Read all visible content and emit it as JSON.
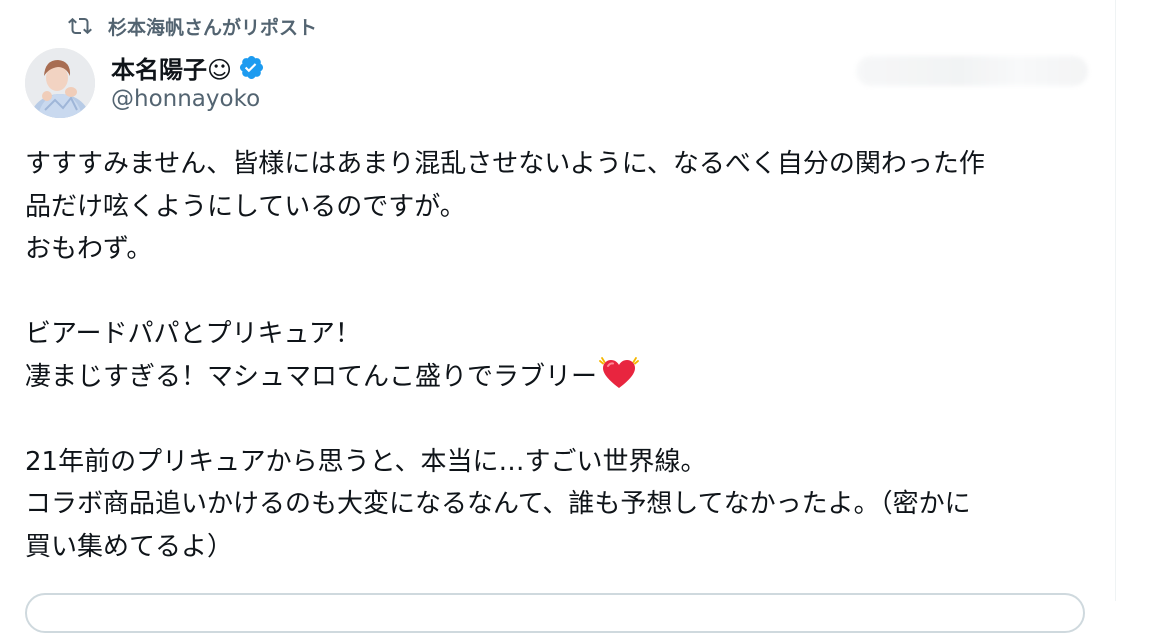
{
  "repost": {
    "label": "杉本海帆さんがリポスト",
    "icon": "repost-icon"
  },
  "author": {
    "display_name": "本名陽子☺",
    "handle": "@honnayoko",
    "verified": true,
    "verified_icon": "verified-badge-icon",
    "verified_color": "#1d9bf0"
  },
  "tweet": {
    "lines": [
      "すすすみません、皆様にはあまり混乱させないように、なるべく自分の関わった作",
      "品だけ呟くようにしているのですが。",
      "おもわず。",
      "",
      "ビアードパパとプリキュア！",
      "凄まじすぎる！マシュマロてんこ盛りでラブリー",
      "",
      "21年前のプリキュアから思うと、本当に…すごい世界線。",
      "コラボ商品追いかけるのも大変になるなんて、誰も予想してなかったよ。（密かに",
      "買い集めてるよ）"
    ],
    "emoji": "beating-heart-emoji"
  },
  "colors": {
    "text_primary": "#0f1419",
    "text_secondary": "#536471",
    "accent": "#1d9bf0",
    "heart": "#e8253f",
    "border": "#cfd9de"
  }
}
